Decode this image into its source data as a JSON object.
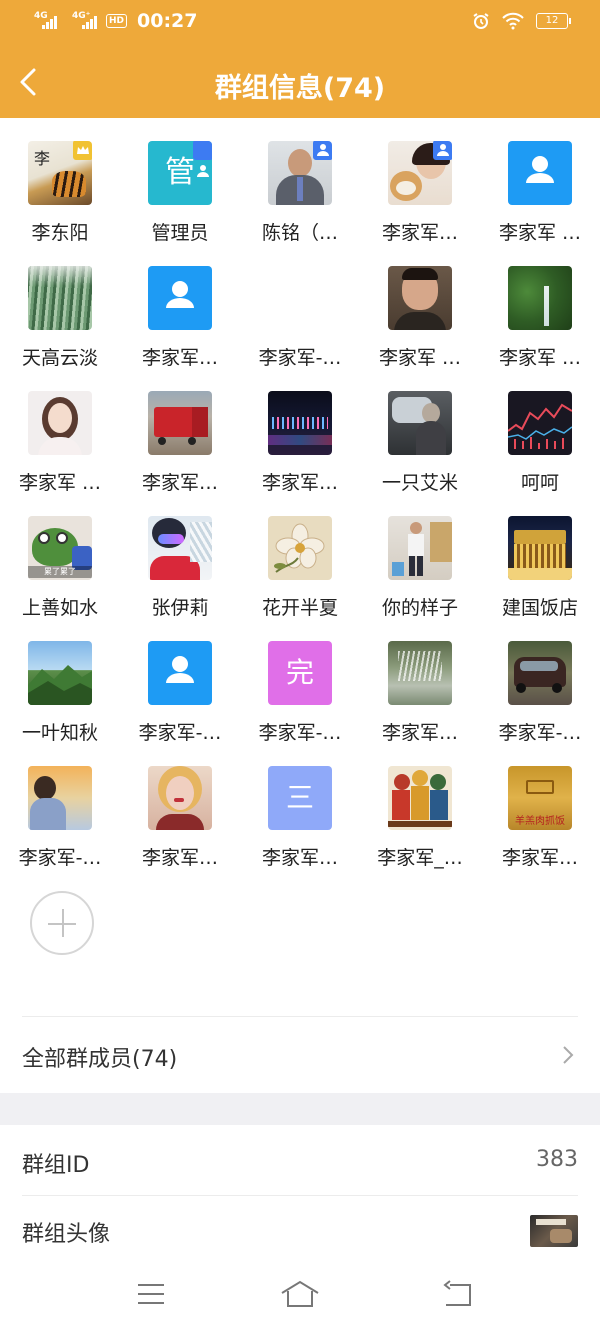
{
  "status_bar": {
    "net1": "4G",
    "net2": "4G⁺",
    "hd": "HD",
    "time": "00:27",
    "battery": "12"
  },
  "nav": {
    "title": "群组信息(74)",
    "back_icon": "chevron-left-icon"
  },
  "members": [
    {
      "name": "李东阳",
      "avatar": "photo-tiger-calligraphy",
      "badge": "owner-crown"
    },
    {
      "name": "管理员",
      "avatar": "text-管",
      "badge": "admin"
    },
    {
      "name": "陈铭（…",
      "avatar": "photo-man-suit",
      "badge": "admin"
    },
    {
      "name": "李家军…",
      "avatar": "photo-woman-dog",
      "badge": "admin"
    },
    {
      "name": "李家军 …",
      "avatar": "default-person",
      "badge": ""
    },
    {
      "name": "天高云淡",
      "avatar": "photo-bamboo",
      "badge": ""
    },
    {
      "name": "李家军…",
      "avatar": "default-person",
      "badge": ""
    },
    {
      "name": "李家军-…",
      "avatar": "",
      "badge": ""
    },
    {
      "name": "李家军 …",
      "avatar": "photo-man-face",
      "badge": ""
    },
    {
      "name": "李家军 …",
      "avatar": "photo-waterfall",
      "badge": ""
    },
    {
      "name": "李家军 …",
      "avatar": "photo-anime-girl",
      "badge": ""
    },
    {
      "name": "李家军…",
      "avatar": "photo-red-truck",
      "badge": ""
    },
    {
      "name": "李家军…",
      "avatar": "photo-night-city",
      "badge": ""
    },
    {
      "name": "一只艾米",
      "avatar": "photo-car-interior",
      "badge": ""
    },
    {
      "name": "呵呵",
      "avatar": "photo-stock-chart",
      "badge": ""
    },
    {
      "name": "上善如水",
      "avatar": "photo-frog-meme",
      "badge": ""
    },
    {
      "name": "张伊莉",
      "avatar": "photo-ski-goggles",
      "badge": ""
    },
    {
      "name": "花开半夏",
      "avatar": "photo-flower-painting",
      "badge": ""
    },
    {
      "name": "你的样子",
      "avatar": "photo-man-standing",
      "badge": ""
    },
    {
      "name": "建国饭店",
      "avatar": "photo-hotel-night",
      "badge": ""
    },
    {
      "name": "一叶知秋",
      "avatar": "photo-mountains",
      "badge": ""
    },
    {
      "name": "李家军-…",
      "avatar": "default-person",
      "badge": ""
    },
    {
      "name": "李家军-…",
      "avatar": "text-完",
      "badge": ""
    },
    {
      "name": "李家军…",
      "avatar": "photo-fountain",
      "badge": ""
    },
    {
      "name": "李家军-…",
      "avatar": "photo-suv",
      "badge": ""
    },
    {
      "name": "李家军-…",
      "avatar": "photo-sunset-man",
      "badge": ""
    },
    {
      "name": "李家军…",
      "avatar": "photo-red-hair-girl",
      "badge": ""
    },
    {
      "name": "李家军…",
      "avatar": "text-三",
      "badge": ""
    },
    {
      "name": "李家军_…",
      "avatar": "photo-guardian-painting",
      "badge": ""
    },
    {
      "name": "李家军…",
      "avatar": "photo-gold-plaque",
      "badge": ""
    }
  ],
  "frog_caption": "累了累了",
  "plaque_caption": "羊羔肉抓饭",
  "text_avatars": {
    "admin": "管",
    "done": "完",
    "three": "三"
  },
  "all_members": {
    "label": "全部群成员(74)"
  },
  "group_id": {
    "label": "群组ID",
    "value": "383"
  },
  "group_avatar": {
    "label": "群组头像"
  },
  "colors": {
    "header": "#eea93a",
    "default_avatar": "#1e9bf4",
    "admin_badge": "#3d7bf2",
    "owner_badge": "#f1c232"
  }
}
